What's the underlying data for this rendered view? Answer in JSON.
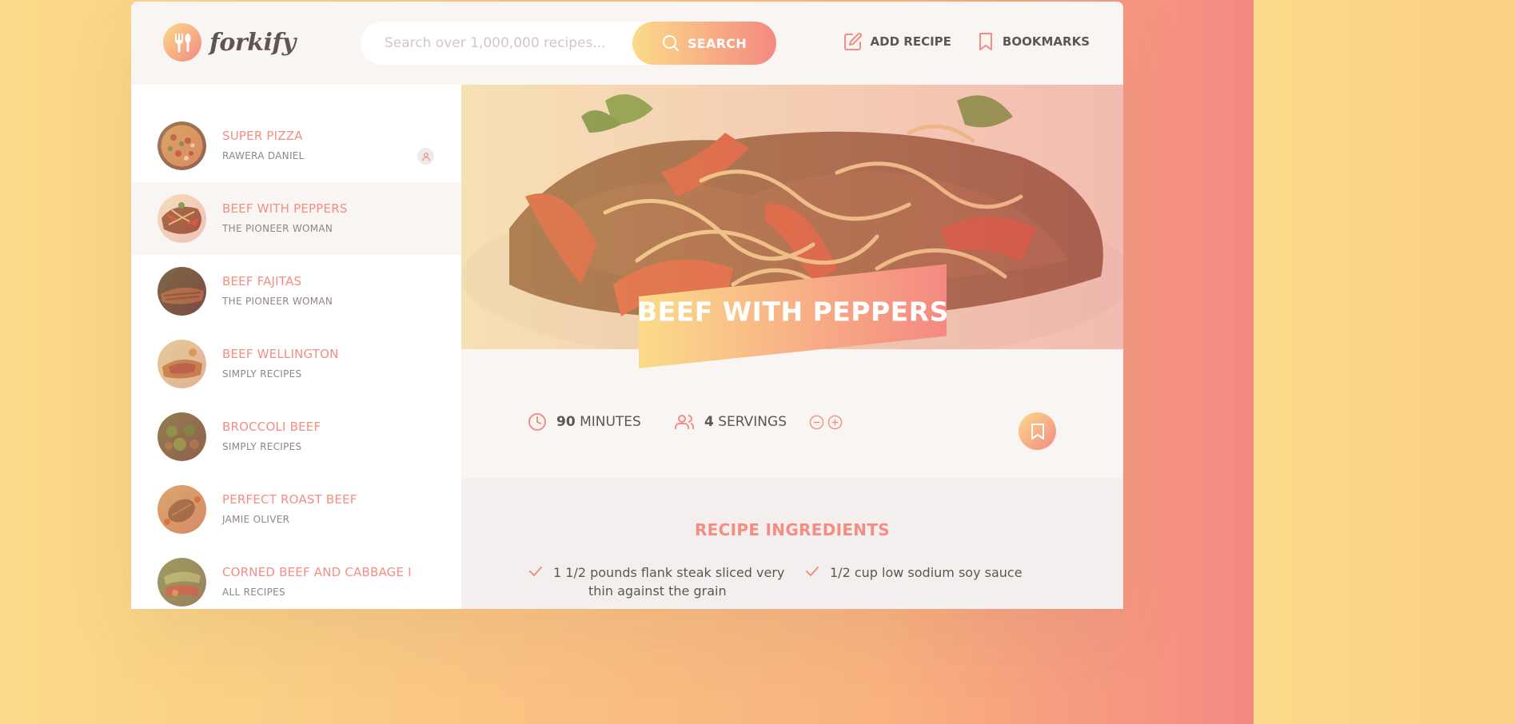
{
  "header": {
    "logo_text": "forkify",
    "search_placeholder": "Search over 1,000,000 recipes...",
    "search_button": "SEARCH",
    "nav": [
      {
        "label": "ADD RECIPE",
        "icon": "edit-icon"
      },
      {
        "label": "BOOKMARKS",
        "icon": "bookmark-icon"
      }
    ]
  },
  "sidebar": {
    "results": [
      {
        "title": "SUPER PIZZA",
        "publisher": "RAWERA DANIEL",
        "user_generated": true,
        "active": false
      },
      {
        "title": "BEEF WITH PEPPERS",
        "publisher": "THE PIONEER WOMAN",
        "active": true
      },
      {
        "title": "BEEF FAJITAS",
        "publisher": "THE PIONEER WOMAN",
        "active": false
      },
      {
        "title": "BEEF WELLINGTON",
        "publisher": "SIMPLY RECIPES",
        "active": false
      },
      {
        "title": "BROCCOLI BEEF",
        "publisher": "SIMPLY RECIPES",
        "active": false
      },
      {
        "title": "PERFECT ROAST BEEF",
        "publisher": "JAMIE OLIVER",
        "active": false
      },
      {
        "title": "CORNED BEEF AND CABBAGE I",
        "publisher": "ALL RECIPES",
        "active": false
      }
    ]
  },
  "recipe": {
    "title": "BEEF WITH PEPPERS",
    "minutes_value": "90",
    "minutes_label": "MINUTES",
    "servings_value": "4",
    "servings_label": "SERVINGS",
    "ingredients_heading": "RECIPE INGREDIENTS",
    "ingredients": [
      {
        "line1": "1 1/2 pounds flank steak sliced very",
        "line2": "thin against the grain"
      },
      {
        "line1": "1/2 cup low sodium soy sauce",
        "line2": ""
      }
    ]
  },
  "colors": {
    "accent": "#f38e82",
    "gradient_start": "#fbdb89",
    "gradient_end": "#f48982",
    "text": "#615551",
    "light_bg": "#f9f5f3"
  }
}
